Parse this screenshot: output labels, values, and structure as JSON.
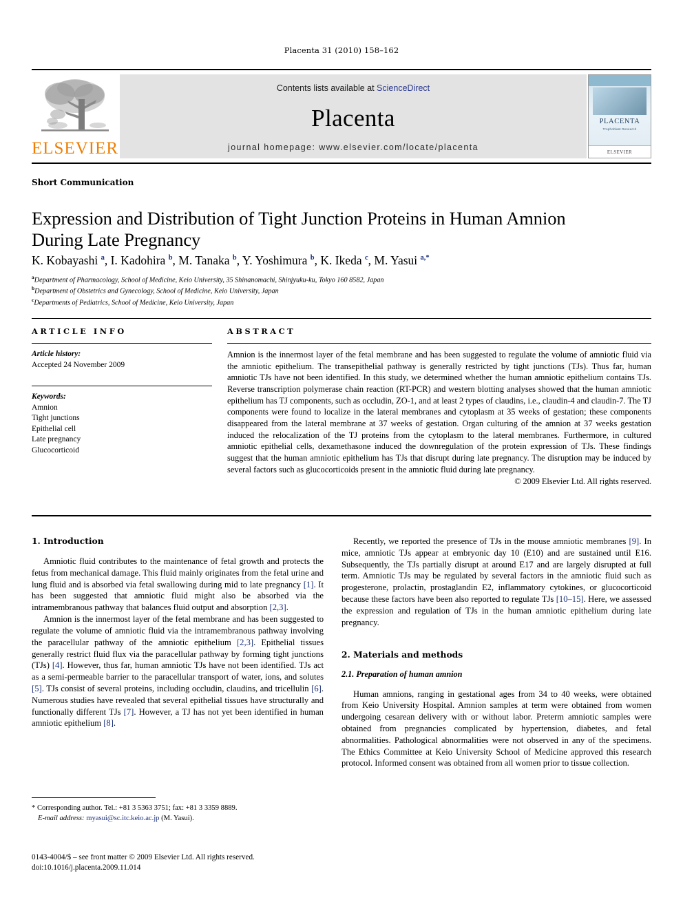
{
  "running_head": "Placenta 31 (2010) 158–162",
  "banner": {
    "contents_prefix": "Contents lists available at ",
    "sciencedirect": "ScienceDirect",
    "journal_name": "Placenta",
    "homepage": "journal homepage: www.elsevier.com/locate/placenta",
    "publisher_logo_text": "ELSEVIER",
    "cover": {
      "title": "PLACENTA",
      "subtitle": "Trophoblast Research",
      "footer": "ELSEVIER"
    },
    "accent_orange": "#f07d00",
    "link_blue": "#2b3a8f"
  },
  "article": {
    "type": "Short Communication",
    "title": "Expression and Distribution of Tight Junction Proteins in Human Amnion During Late Pregnancy",
    "authors_html": "K. Kobayashi <sup>a</sup>, I. Kadohira <sup>b</sup>, M. Tanaka <sup>b</sup>, Y. Yoshimura <sup>b</sup>, K. Ikeda <sup>c</sup>, M. Yasui <sup>a,*</sup>",
    "affiliations": [
      {
        "marker": "a",
        "text": "Department of Pharmacology, School of Medicine, Keio University, 35 Shinanomachi, Shinjyuku-ku, Tokyo 160 8582, Japan"
      },
      {
        "marker": "b",
        "text": "Department of Obstetrics and Gynecology, School of Medicine, Keio University, Japan"
      },
      {
        "marker": "c",
        "text": "Departments of Pediatrics, School of Medicine, Keio University, Japan"
      }
    ]
  },
  "article_info": {
    "heading": "ARTICLE INFO",
    "history_label": "Article history:",
    "history_value": "Accepted 24 November 2009",
    "keywords_label": "Keywords:",
    "keywords": [
      "Amnion",
      "Tight junctions",
      "Epithelial cell",
      "Late pregnancy",
      "Glucocorticoid"
    ]
  },
  "abstract": {
    "heading": "ABSTRACT",
    "text": "Amnion is the innermost layer of the fetal membrane and has been suggested to regulate the volume of amniotic fluid via the amniotic epithelium. The transepithelial pathway is generally restricted by tight junctions (TJs). Thus far, human amniotic TJs have not been identified. In this study, we determined whether the human amniotic epithelium contains TJs. Reverse transcription polymerase chain reaction (RT-PCR) and western blotting analyses showed that the human amniotic epithelium has TJ components, such as occludin, ZO-1, and at least 2 types of claudins, i.e., claudin-4 and claudin-7. The TJ components were found to localize in the lateral membranes and cytoplasm at 35 weeks of gestation; these components disappeared from the lateral membrane at 37 weeks of gestation. Organ culturing of the amnion at 37 weeks gestation induced the relocalization of the TJ proteins from the cytoplasm to the lateral membranes. Furthermore, in cultured amniotic epithelial cells, dexamethasone induced the downregulation of the protein expression of TJs. These findings suggest that the human amniotic epithelium has TJs that disrupt during late pregnancy. The disruption may be induced by several factors such as glucocorticoids present in the amniotic fluid during late pregnancy.",
    "copyright": "© 2009 Elsevier Ltd. All rights reserved."
  },
  "sections": {
    "introduction": {
      "heading": "1. Introduction",
      "paragraph1_html": "Amniotic fluid contributes to the maintenance of fetal growth and protects the fetus from mechanical damage. This fluid mainly originates from the fetal urine and lung fluid and is absorbed via fetal swallowing during mid to late pregnancy <span class=\"ref\">[1]</span>. It has been suggested that amniotic fluid might also be absorbed via the intramembranous pathway that balances fluid output and absorption <span class=\"ref\">[2,3]</span>.",
      "paragraph2_html": "Amnion is the innermost layer of the fetal membrane and has been suggested to regulate the volume of amniotic fluid via the intramembranous pathway involving the paracellular pathway of the amniotic epithelium <span class=\"ref\">[2,3]</span>. Epithelial tissues generally restrict fluid flux via the paracellular pathway by forming tight junctions (TJs) <span class=\"ref\">[4]</span>. However, thus far, human amniotic TJs have not been identified. TJs act as a semi-permeable barrier to the paracellular transport of water, ions, and solutes <span class=\"ref\">[5]</span>. TJs consist of several proteins, including occludin, claudins, and tricellulin <span class=\"ref\">[6]</span>. Numerous studies have revealed that several epithelial tissues have structurally and functionally different TJs <span class=\"ref\">[7]</span>. However, a TJ has not yet been identified in human amniotic epithelium <span class=\"ref\">[8]</span>.",
      "paragraph3_html": "Recently, we reported the presence of TJs in the mouse amniotic membranes <span class=\"ref\">[9]</span>. In mice, amniotic TJs appear at embryonic day 10 (E10) and are sustained until E16. Subsequently, the TJs partially disrupt at around E17 and are largely disrupted at full term. Amniotic TJs may be regulated by several factors in the amniotic fluid such as progesterone, prolactin, prostaglandin E2, inflammatory cytokines, or glucocorticoid because these factors have been also reported to regulate TJs <span class=\"ref\">[10–15]</span>. Here, we assessed the expression and regulation of TJs in the human amniotic epithelium during late pregnancy."
    },
    "materials": {
      "heading": "2. Materials and methods",
      "subheading": "2.1. Preparation of human amnion",
      "paragraph1_html": "Human amnions, ranging in gestational ages from 34 to 40 weeks, were obtained from Keio University Hospital. Amnion samples at term were obtained from women undergoing cesarean delivery with or without labor. Preterm amniotic samples were obtained from pregnancies complicated by hypertension, diabetes, and fetal abnormalities. Pathological abnormalities were not observed in any of the specimens. The Ethics Committee at Keio University School of Medicine approved this research protocol. Informed consent was obtained from all women prior to tissue collection."
    }
  },
  "footnotes": {
    "corresponding_html": "* Corresponding author. Tel.: +81 3 5363 3751; fax: +81 3 3359 8889.",
    "email_label": "E-mail address:",
    "email": "myasui@sc.itc.keio.ac.jp",
    "email_suffix": "(M. Yasui)."
  },
  "imprint": {
    "line1": "0143-4004/$ – see front matter © 2009 Elsevier Ltd. All rights reserved.",
    "line2": "doi:10.1016/j.placenta.2009.11.014"
  }
}
